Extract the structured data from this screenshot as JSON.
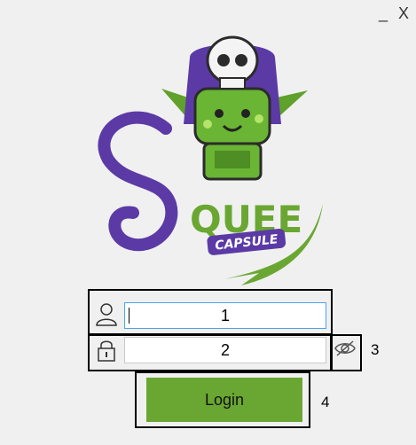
{
  "window": {
    "minimize_label": "_",
    "close_label": "X"
  },
  "logo": {
    "brand": "QUEE",
    "tagline": "CAPSULE"
  },
  "username": {
    "value": "1",
    "icon": "user-icon"
  },
  "password": {
    "value": "2",
    "icon": "lock-icon",
    "visibility_icon": "eye-slash-icon"
  },
  "callouts": {
    "visibility": "3",
    "login": "4"
  },
  "login": {
    "label": "Login"
  },
  "colors": {
    "accent_green": "#6aa732",
    "brand_purple": "#5b3aa5",
    "focus_blue": "#4aa3ef"
  }
}
